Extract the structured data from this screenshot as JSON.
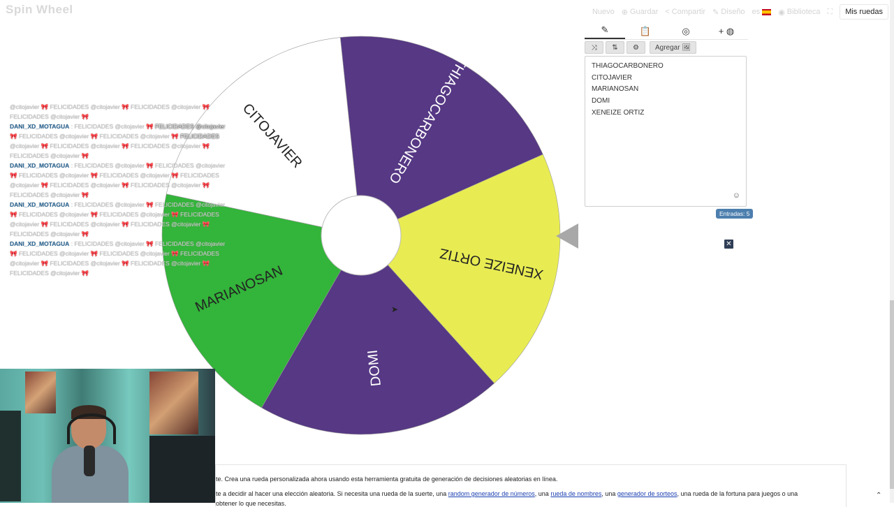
{
  "app": {
    "logo": "Spin Wheel"
  },
  "topnav": [
    {
      "icon": "",
      "label": "Nuevo"
    },
    {
      "icon": "⊕",
      "label": "Guardar"
    },
    {
      "icon": "<",
      "label": "Compartir"
    },
    {
      "icon": "✎",
      "label": "Diseño"
    },
    {
      "icon": "",
      "label": "es"
    },
    {
      "icon": "◉",
      "label": "Biblioteca"
    },
    {
      "icon": "⛶",
      "label": ""
    }
  ],
  "mis_ruedas": "Mis ruedas",
  "wheel": {
    "segments": [
      {
        "label": "THIAGOCARBONERO",
        "color": "#563884",
        "text_color": "#ffffff"
      },
      {
        "label": "XENEIZE ORTIZ",
        "color": "#e8ec52",
        "text_color": "#222222"
      },
      {
        "label": "DOMI",
        "color": "#563884",
        "text_color": "#ffffff"
      },
      {
        "label": "MARIANOSAN",
        "color": "#33b43a",
        "text_color": "#222222"
      },
      {
        "label": "CITOJAVIER",
        "color": "#ffffff",
        "text_color": "#222222"
      }
    ]
  },
  "chat": [
    [
      {
        "t": "@citojavier 🎀 FELICIDADES @citojavier 🎀 FELICIDADES @citojavier 🎀"
      }
    ],
    [
      {
        "t": "FELICIDADES @citojavier 🎀"
      }
    ],
    [
      {
        "t": "DANI_XD_MOTAGUA",
        "c": "user"
      },
      {
        "t": " : FELICIDADES @citojavier 🎀 "
      },
      {
        "t": "FELICIDADES @citojavier",
        "c": "bright"
      }
    ],
    [
      {
        "t": "🎀 FELICIDADES @citojavier 🎀 FELICIDADES @citojavier 🎀 "
      },
      {
        "t": "FELICIDADES",
        "c": "bright"
      }
    ],
    [
      {
        "t": "@citojavier 🎀 FELICIDADES @citojavier 🎀 FELICIDADES @citojavier 🎀"
      }
    ],
    [
      {
        "t": "FELICIDADES @citojavier 🎀"
      }
    ],
    [
      {
        "t": "DANI_XD_MOTAGUA",
        "c": "user"
      },
      {
        "t": " : FELICIDADES @citojavier 🎀 FELICIDADES @citojavier"
      }
    ],
    [
      {
        "t": "🎀 FELICIDADES @citojavier 🎀 FELICIDADES @citojavier 🎀 FELICIDADES"
      }
    ],
    [
      {
        "t": "@citojavier 🎀 FELICIDADES @citojavier 🎀 FELICIDADES @citojavier 🎀"
      }
    ],
    [
      {
        "t": "FELICIDADES @citojavier 🎀"
      }
    ],
    [
      {
        "t": "DANI_XD_MOTAGUA",
        "c": "user"
      },
      {
        "t": " : FELICIDADES @citojavier 🎀 FELICIDADES @citojavier"
      }
    ],
    [
      {
        "t": "🎀 FELICIDADES @citojavier 🎀 FELICIDADES @citojavier 🎀 FELICIDADES"
      }
    ],
    [
      {
        "t": "@citojavier 🎀 FELICIDADES @citojavier 🎀 FELICIDADES @citojavier 🎀"
      }
    ],
    [
      {
        "t": "FELICIDADES @citojavier 🎀"
      }
    ],
    [
      {
        "t": "DANI_XD_MOTAGUA",
        "c": "user"
      },
      {
        "t": " : FELICIDADES @citojavier 🎀 FELICIDADES @citojavier"
      }
    ],
    [
      {
        "t": "🎀 FELICIDADES @citojavier 🎀 FELICIDADES @citojavier 🎀 FELICIDADES"
      }
    ],
    [
      {
        "t": "@citojavier 🎀 FELICIDADES @citojavier 🎀 FELICIDADES @citojavier 🎀"
      }
    ],
    [
      {
        "t": "FELICIDADES @citojavier 🎀"
      }
    ]
  ],
  "panel": {
    "tabs": [
      {
        "icon": "pencil-icon",
        "glyph": "✎"
      },
      {
        "icon": "clipboard-icon",
        "glyph": "📋"
      },
      {
        "icon": "eye-slash-icon",
        "glyph": "◎"
      },
      {
        "icon": "add-wheel-icon",
        "glyph": "+ ◍"
      }
    ],
    "toolbar": {
      "shuffle": "⤨",
      "sort": "⇅",
      "settings": "⚙",
      "agregar": "Agregar 🖼"
    },
    "entries": [
      "THIAGOCARBONERO",
      "CITOJAVIER",
      "MARIANOSAN",
      "DOMI",
      "XENEIZE ORTIZ"
    ],
    "smiley": "☺",
    "count_label": "Entradas: 5",
    "close": "✕"
  },
  "article": {
    "line1": "te. Crea una rueda personalizada ahora usando esta herramienta gratuita de generación de decisiones aleatorias en línea.",
    "line2_pre": "te a decidir al hacer una elección aleatoria. Si necesita una rueda de la suerte, una ",
    "link1": "random generador de números",
    "sep1": ", una ",
    "link2": "rueda de nombres",
    "sep2": ", una ",
    "link3": "generador de sorteos",
    "line2_post": ", una rueda de la fortuna para juegos o una",
    "line3": "obtener lo que necesitas."
  },
  "scroll_top": "⌃"
}
